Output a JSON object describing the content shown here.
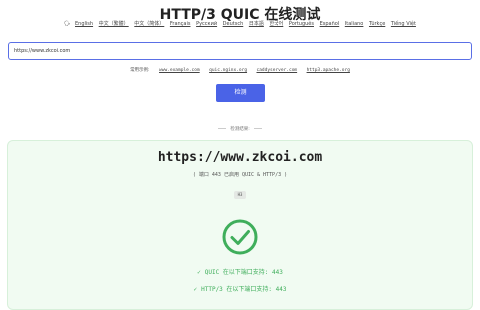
{
  "page": {
    "title": "HTTP/3 QUIC 在线测试"
  },
  "languages": [
    "English",
    "中文（繁體）",
    "中文（简体）",
    "Français",
    "Русский",
    "Deutsch",
    "日本語",
    "한국어",
    "Português",
    "Español",
    "Italiano",
    "Türkçe",
    "Tiếng Việt"
  ],
  "search": {
    "value": "https://www.zkcoi.com"
  },
  "examples": {
    "label": "常用示例:",
    "items": [
      "www.example.com",
      "quic.nginx.org",
      "caddyserver.com",
      "http3.apache.org"
    ]
  },
  "detect_button": {
    "label": "检测"
  },
  "result": {
    "section_label": "检测结果:",
    "domain": "https://www.zkcoi.com",
    "port_info": "( 端口 443 已启用 QUIC & HTTP/3 )",
    "badge": "H3",
    "quic_support": "QUIC 在以下端口支持: 443",
    "http3_support": "HTTP/3 在以下端口支持: 443"
  },
  "colors": {
    "accent": "#4a63e7",
    "success": "#3fae5b",
    "card_bg": "#f1fbf2"
  },
  "icons": {
    "language": "globe-icon",
    "status": "check-circle-icon",
    "support_item": "check-mark-icon"
  }
}
